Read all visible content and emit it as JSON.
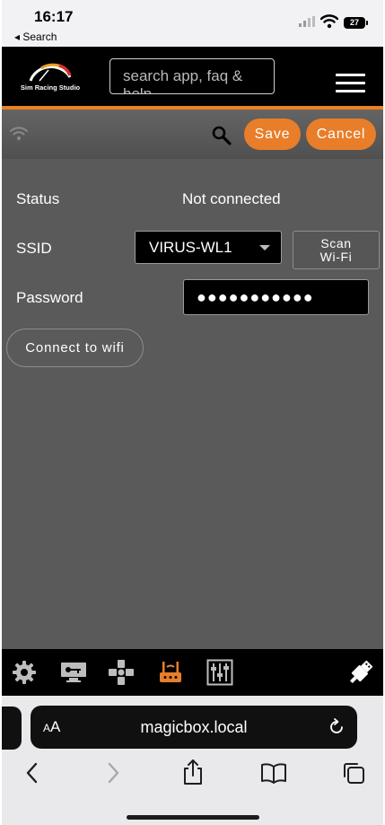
{
  "status_bar": {
    "time": "16:17",
    "back_label": "◂ Search",
    "battery": "27"
  },
  "header": {
    "logo_text": "Sim Racing Studio",
    "search_placeholder": "search app, faq & help"
  },
  "toolbar": {
    "save_label": "Save",
    "cancel_label": "Cancel"
  },
  "form": {
    "status_label": "Status",
    "status_value": "Not connected",
    "ssid_label": "SSID",
    "ssid_selected": "VIRUS-WL1",
    "scan_label_line1": "Scan",
    "scan_label_line2": "Wi-Fi",
    "password_label": "Password",
    "password_mask": "●●●●●●●●●●●",
    "connect_label": "Connect to wifi"
  },
  "bottom_nav": {
    "items": [
      "gear-icon",
      "monitor-key-icon",
      "dpad-icon",
      "router-icon",
      "sliders-icon",
      "usb-icon"
    ],
    "active": "router-icon",
    "accent_color": "#e87e2a"
  },
  "safari": {
    "aa_label_small": "A",
    "aa_label_large": "A",
    "url": "magicbox.local"
  },
  "colors": {
    "accent": "#ec7f21",
    "panel": "#5a5a5a",
    "header": "#000000"
  }
}
